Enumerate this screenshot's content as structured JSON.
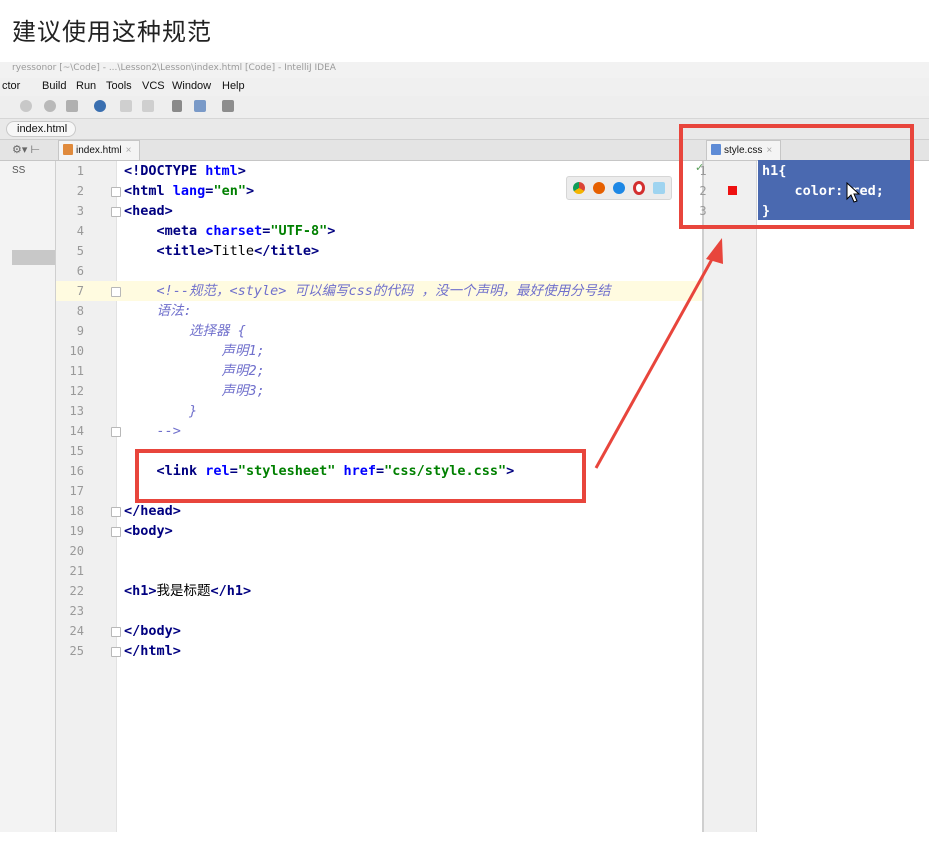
{
  "heading": "建议使用这种规范",
  "titlebar_faded": "ryessonor  [~\\Code]  -  ...\\Lesson2\\Lesson\\index.html  [Code]  -  IntelliJ IDEA",
  "menu": {
    "items": [
      "ctor",
      "Build",
      "Run",
      "Tools",
      "VCS",
      "Window",
      "Help"
    ]
  },
  "breadcrumb": "index.html",
  "tabs": {
    "left": {
      "label": "index.html",
      "close": "×"
    },
    "right": {
      "label": "style.css",
      "close": "×"
    }
  },
  "left_panel_label": "SS",
  "html_editor": {
    "lines": [
      {
        "n": "1",
        "tokens": [
          [
            "t",
            "<!DOCTYPE "
          ],
          [
            "a",
            "html"
          ],
          [
            "t",
            ">"
          ]
        ]
      },
      {
        "n": "2",
        "tokens": [
          [
            "t",
            "<html "
          ],
          [
            "a",
            "lang"
          ],
          [
            "t",
            "="
          ],
          [
            "s",
            "\"en\""
          ],
          [
            "t",
            ">"
          ]
        ]
      },
      {
        "n": "3",
        "tokens": [
          [
            "t",
            "<head>"
          ]
        ]
      },
      {
        "n": "4",
        "tokens": [
          [
            "x",
            "    "
          ],
          [
            "t",
            "<meta "
          ],
          [
            "a",
            "charset"
          ],
          [
            "t",
            "="
          ],
          [
            "s",
            "\"UTF-8\""
          ],
          [
            "t",
            ">"
          ]
        ]
      },
      {
        "n": "5",
        "tokens": [
          [
            "x",
            "    "
          ],
          [
            "t",
            "<title>"
          ],
          [
            "x",
            "Title"
          ],
          [
            "t",
            "</title>"
          ]
        ]
      },
      {
        "n": "6",
        "tokens": []
      },
      {
        "n": "7",
        "tokens": [
          [
            "x",
            "    "
          ],
          [
            "c",
            "<!--规范，<style> 可以编写css的代码 ，没一个声明，最好使用分号结"
          ]
        ]
      },
      {
        "n": "8",
        "tokens": [
          [
            "x",
            "    "
          ],
          [
            "c",
            "语法:"
          ]
        ]
      },
      {
        "n": "9",
        "tokens": [
          [
            "x",
            "        "
          ],
          [
            "c",
            "选择器 {"
          ]
        ]
      },
      {
        "n": "10",
        "tokens": [
          [
            "x",
            "            "
          ],
          [
            "c",
            "声明1;"
          ]
        ]
      },
      {
        "n": "11",
        "tokens": [
          [
            "x",
            "            "
          ],
          [
            "c",
            "声明2;"
          ]
        ]
      },
      {
        "n": "12",
        "tokens": [
          [
            "x",
            "            "
          ],
          [
            "c",
            "声明3;"
          ]
        ]
      },
      {
        "n": "13",
        "tokens": [
          [
            "x",
            "        "
          ],
          [
            "c",
            "}"
          ]
        ]
      },
      {
        "n": "14",
        "tokens": [
          [
            "x",
            "    "
          ],
          [
            "c",
            "-->"
          ]
        ]
      },
      {
        "n": "15",
        "tokens": []
      },
      {
        "n": "16",
        "tokens": [
          [
            "x",
            "    "
          ],
          [
            "t",
            "<link "
          ],
          [
            "a",
            "rel"
          ],
          [
            "t",
            "="
          ],
          [
            "s",
            "\"stylesheet\""
          ],
          [
            "x",
            " "
          ],
          [
            "a",
            "href"
          ],
          [
            "t",
            "="
          ],
          [
            "s",
            "\"css/style.css\""
          ],
          [
            "t",
            ">"
          ]
        ]
      },
      {
        "n": "17",
        "tokens": []
      },
      {
        "n": "18",
        "tokens": [
          [
            "t",
            "</head>"
          ]
        ]
      },
      {
        "n": "19",
        "tokens": [
          [
            "t",
            "<body>"
          ]
        ]
      },
      {
        "n": "20",
        "tokens": []
      },
      {
        "n": "21",
        "tokens": []
      },
      {
        "n": "22",
        "tokens": [
          [
            "t",
            "<h1>"
          ],
          [
            "x",
            "我是标题"
          ],
          [
            "t",
            "</h1>"
          ]
        ]
      },
      {
        "n": "23",
        "tokens": []
      },
      {
        "n": "24",
        "tokens": [
          [
            "t",
            "</body>"
          ]
        ]
      },
      {
        "n": "25",
        "tokens": [
          [
            "t",
            "</html>"
          ]
        ]
      }
    ]
  },
  "css_editor": {
    "lines": [
      {
        "n": "1",
        "text": "h1{"
      },
      {
        "n": "2",
        "text": "    color: red;"
      },
      {
        "n": "3",
        "text": "}"
      }
    ],
    "swatch_color": "#ee1111"
  },
  "colors": {
    "annotation_red": "#e8453c",
    "selection_blue": "#4a69b0",
    "tag_navy": "#000080",
    "attr_blue": "#0000ff",
    "string_green": "#008000",
    "comment_purple": "#7070cc"
  },
  "browser_icons": [
    "chrome-icon",
    "firefox-icon",
    "safari-icon",
    "opera-icon",
    "ie-icon"
  ]
}
